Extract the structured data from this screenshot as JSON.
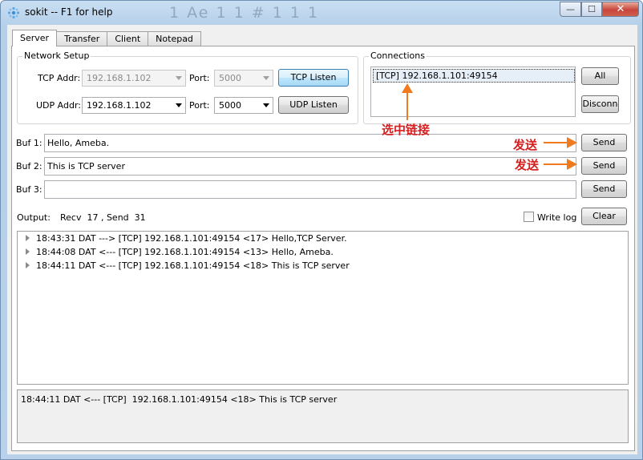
{
  "window": {
    "title": "sokit -- F1 for help",
    "ghost_title": "1 Ae 1 1 # 1 1 1",
    "close_glyph": "✕",
    "min_glyph": "—",
    "max_glyph": "☐"
  },
  "tabs": [
    {
      "label": "Server",
      "active": true
    },
    {
      "label": "Transfer",
      "active": false
    },
    {
      "label": "Client",
      "active": false
    },
    {
      "label": "Notepad",
      "active": false
    }
  ],
  "network_setup": {
    "title": "Network Setup",
    "tcp_addr_label": "TCP Addr:",
    "tcp_addr_value": "192.168.1.102",
    "tcp_port_label": "Port:",
    "tcp_port_value": "5000",
    "tcp_listen_button": "TCP Listen",
    "udp_addr_label": "UDP Addr:",
    "udp_addr_value": "192.168.1.102",
    "udp_port_label": "Port:",
    "udp_port_value": "5000",
    "udp_listen_button": "UDP Listen"
  },
  "connections": {
    "title": "Connections",
    "items": [
      "[TCP] 192.168.1.101:49154"
    ],
    "all_button": "All",
    "disconn_button": "Disconn"
  },
  "buffers": [
    {
      "label": "Buf 1:",
      "value": "Hello, Ameba.",
      "send_label": "Send"
    },
    {
      "label": "Buf 2:",
      "value": "This is TCP server",
      "send_label": "Send"
    },
    {
      "label": "Buf 3:",
      "value": "",
      "send_label": "Send"
    }
  ],
  "output": {
    "label": "Output:",
    "stats": "Recv  17 , Send  31",
    "write_log_label": "Write log",
    "write_log_checked": false,
    "clear_button": "Clear",
    "lines": [
      "18:43:31 DAT ---> [TCP] 192.168.1.101:49154 <17> Hello,TCP Server.",
      "18:44:08 DAT <--- [TCP] 192.168.1.101:49154 <13> Hello, Ameba.",
      "18:44:11 DAT <--- [TCP] 192.168.1.101:49154 <18> This is TCP server"
    ],
    "status_text": "18:44:11 DAT <--- [TCP]  192.168.1.101:49154 <18> This is TCP server"
  },
  "annotations": {
    "select_connection": "选中链接",
    "send_1": "发送",
    "send_2": "发送",
    "arrow_color": "#f07a20",
    "text_color": "#d42020"
  },
  "colors": {
    "titlebar": "#c9dff3",
    "close": "#c7453a",
    "focus_button": "#bee6fd"
  }
}
